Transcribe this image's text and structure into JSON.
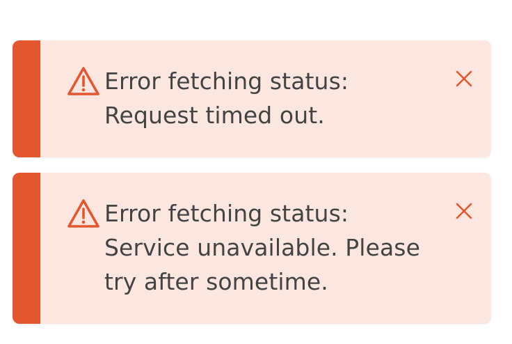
{
  "alerts": [
    {
      "title": "Error fetching status:",
      "detail_lines": [
        "Request timed out."
      ],
      "icon": "warning-triangle-icon",
      "close_icon": "close-icon"
    },
    {
      "title": "Error fetching status:",
      "detail_lines": [
        "Service unavailable. Please",
        "try after sometime."
      ],
      "icon": "warning-triangle-icon",
      "close_icon": "close-icon"
    }
  ],
  "colors": {
    "accent": "#e4572e",
    "alert_background": "#fbe7e0",
    "text": "#434343"
  }
}
